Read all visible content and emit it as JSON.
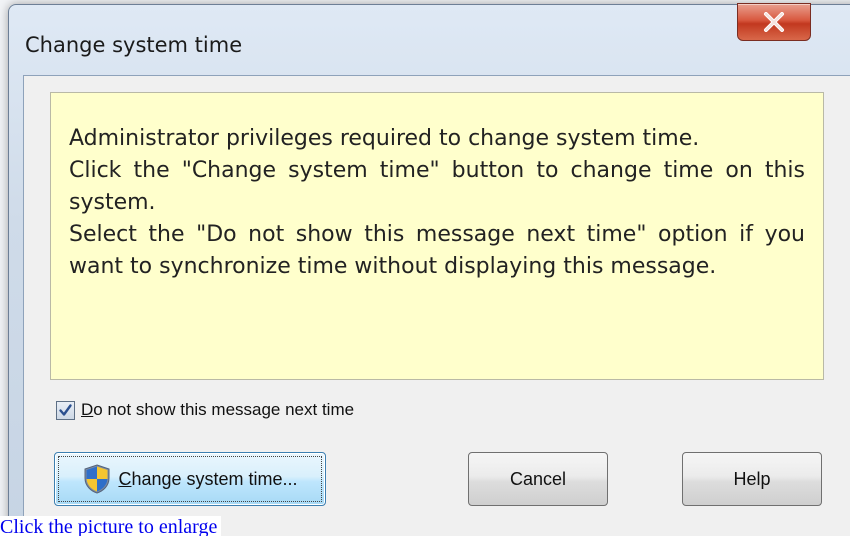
{
  "window": {
    "title": "Change system time"
  },
  "message": {
    "lines": [
      "Administrator privileges required to change system time.",
      "Click the \"Change system time\" button to change time on this system.",
      "Select the \"Do not show this message next time\" option if you want to synchronize time without displaying this message."
    ]
  },
  "checkbox": {
    "label_underlined": "D",
    "label_rest": "o not show this message next time",
    "checked": true
  },
  "buttons": {
    "change_underlined": "C",
    "change_rest": "hange system time...",
    "cancel": "Cancel",
    "help": "Help"
  },
  "link": {
    "text": "Click the picture to enlarge"
  },
  "colors": {
    "message_background": "#ffffcc",
    "close_button": "#d8583f",
    "link": "#0000ee"
  },
  "icons": {
    "close": "close-icon",
    "checkmark": "checkmark-icon",
    "uac_shield": "uac-shield-icon"
  }
}
